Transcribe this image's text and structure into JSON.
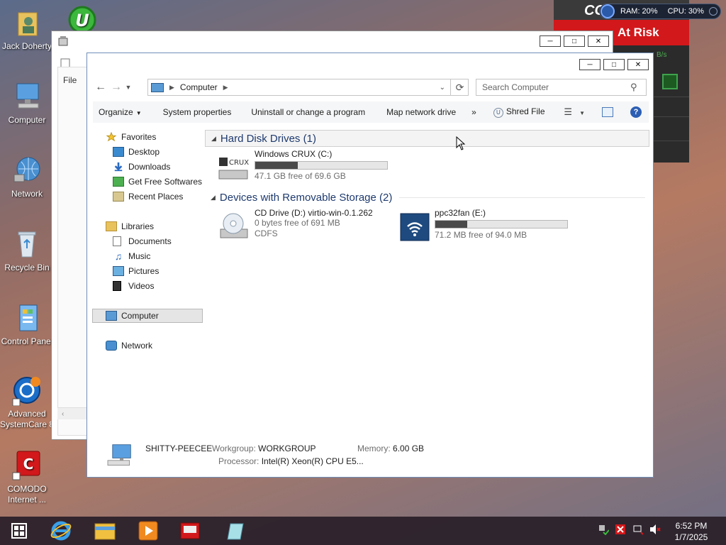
{
  "desktop": {
    "icons": [
      {
        "label": "Jack Doherty"
      },
      {
        "label": "Computer"
      },
      {
        "label": "Network"
      },
      {
        "label": "Recycle Bin"
      },
      {
        "label": "Control Panel"
      },
      {
        "label": "Advanced SystemCare 8"
      },
      {
        "label": "COMODO Internet ..."
      }
    ]
  },
  "comodo_widget": {
    "brand": "CO",
    "risk": "At Risk",
    "speed_unit": "B/s",
    "ram": "RAM: 20%",
    "cpu": "CPU: 30%"
  },
  "bg_window": {
    "menu_file": "File"
  },
  "explorer": {
    "address": {
      "crumb": "Computer",
      "search_placeholder": "Search Computer"
    },
    "toolbar": {
      "organize": "Organize",
      "system_properties": "System properties",
      "uninstall": "Uninstall or change a program",
      "map_drive": "Map network drive",
      "more": "»",
      "shred": "Shred File"
    },
    "nav": {
      "favorites": "Favorites",
      "desktop": "Desktop",
      "downloads": "Downloads",
      "get_free": "Get Free Softwares",
      "recent": "Recent Places",
      "libraries": "Libraries",
      "documents": "Documents",
      "music": "Music",
      "pictures": "Pictures",
      "videos": "Videos",
      "computer": "Computer",
      "network": "Network"
    },
    "groups": {
      "hdd": "Hard Disk Drives (1)",
      "removable": "Devices with Removable Storage (2)"
    },
    "drives": [
      {
        "name": "Windows CRUX (C:)",
        "free_text": "47.1 GB free of 69.6 GB",
        "used_fraction": 0.32,
        "badge": "CRUX"
      },
      {
        "name": "CD Drive (D:) virtio-win-0.1.262",
        "free_text": "0 bytes free of 691 MB",
        "fs": "CDFS"
      },
      {
        "name": "ppc32fan (E:)",
        "free_text": "71.2 MB free of 94.0 MB",
        "used_fraction": 0.24
      }
    ],
    "details": {
      "pc_name": "SHITTY-PEECEE",
      "workgroup_label": "Workgroup:",
      "workgroup": "WORKGROUP",
      "memory_label": "Memory:",
      "memory": "6.00 GB",
      "processor_label": "Processor:",
      "processor": "Intel(R) Xeon(R) CPU E5..."
    }
  },
  "taskbar": {
    "time": "6:52 PM",
    "date": "1/7/2025"
  }
}
